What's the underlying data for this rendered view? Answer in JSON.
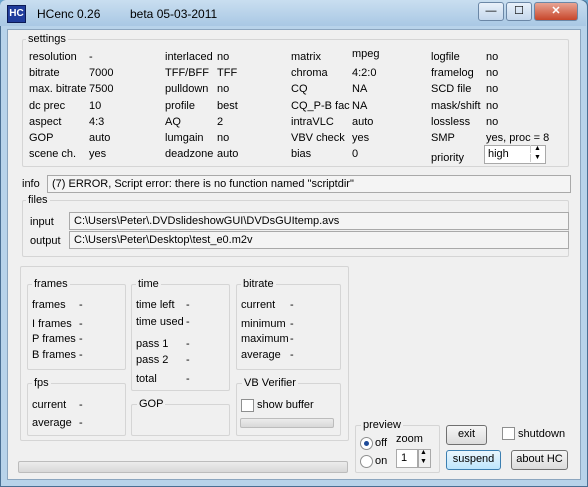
{
  "window": {
    "app_name": "HCenc 0.26",
    "version": "beta 05-03-2011",
    "logo_text": "HC",
    "minimize_glyph": "—",
    "maximize_glyph": "☐",
    "close_glyph": "✕"
  },
  "settings": {
    "title": "settings",
    "col1": [
      {
        "label": "resolution",
        "value": "-"
      },
      {
        "label": "bitrate",
        "value": "7000"
      },
      {
        "label": "max. bitrate",
        "value": "7500"
      },
      {
        "label": "dc prec",
        "value": "10"
      },
      {
        "label": "aspect",
        "value": "4:3"
      },
      {
        "label": "GOP",
        "value": "auto"
      },
      {
        "label": "scene ch.",
        "value": "yes"
      }
    ],
    "col2": [
      {
        "label": "interlaced",
        "value": "no"
      },
      {
        "label": "TFF/BFF",
        "value": "TFF"
      },
      {
        "label": "pulldown",
        "value": "no"
      },
      {
        "label": "profile",
        "value": "best"
      },
      {
        "label": "AQ",
        "value": "2"
      },
      {
        "label": "lumgain",
        "value": "no"
      },
      {
        "label": "deadzone",
        "value": "auto"
      }
    ],
    "col3": [
      {
        "label": "matrix",
        "value": "mpeg"
      },
      {
        "label": "chroma",
        "value": "4:2:0"
      },
      {
        "label": "CQ",
        "value": "NA"
      },
      {
        "label": "CQ_P-B fac",
        "value": "NA"
      },
      {
        "label": "intraVLC",
        "value": "auto"
      },
      {
        "label": "VBV check",
        "value": "yes"
      },
      {
        "label": "bias",
        "value": "0"
      }
    ],
    "col4": [
      {
        "label": "logfile",
        "value": "no"
      },
      {
        "label": "framelog",
        "value": "no"
      },
      {
        "label": "SCD file",
        "value": "no"
      },
      {
        "label": "mask/shift",
        "value": "no"
      },
      {
        "label": "lossless",
        "value": "no"
      },
      {
        "label": "SMP",
        "value": "yes,  proc = 8"
      }
    ],
    "priority": {
      "label": "priority",
      "value": "high"
    }
  },
  "info": {
    "label": "info",
    "message": "(7) ERROR, Script error: there is no function named \"scriptdir\""
  },
  "files": {
    "title": "files",
    "input_label": "input",
    "input_value": "C:\\Users\\Peter\\.DVDslideshowGUI\\DVDsGUItemp.avs",
    "output_label": "output",
    "output_value": "C:\\Users\\Peter\\Desktop\\test_e0.m2v"
  },
  "frames": {
    "title": "frames",
    "rows": [
      {
        "label": "frames",
        "value": "-"
      },
      {
        "label": "I frames",
        "value": "-"
      },
      {
        "label": "P frames",
        "value": "-"
      },
      {
        "label": "B frames",
        "value": "-"
      }
    ]
  },
  "time": {
    "title": "time",
    "rows": [
      {
        "label": "time left",
        "value": "-"
      },
      {
        "label": "time used",
        "value": "-"
      },
      {
        "label": "pass 1",
        "value": "-"
      },
      {
        "label": "pass 2",
        "value": "-"
      },
      {
        "label": "total",
        "value": "-"
      }
    ]
  },
  "bitrate": {
    "title": "bitrate",
    "rows": [
      {
        "label": "current",
        "value": "-"
      },
      {
        "label": "minimum",
        "value": "-"
      },
      {
        "label": "maximum",
        "value": "-"
      },
      {
        "label": "average",
        "value": "-"
      }
    ]
  },
  "fps": {
    "title": "fps",
    "rows": [
      {
        "label": "current",
        "value": "-"
      },
      {
        "label": "average",
        "value": "-"
      }
    ]
  },
  "gop": {
    "title": "GOP"
  },
  "vb_verifier": {
    "title": "VB Verifier",
    "show_buffer": "show buffer"
  },
  "preview": {
    "title": "preview",
    "off": "off",
    "on": "on",
    "zoom_label": "zoom",
    "zoom_value": "1",
    "selected": "off"
  },
  "buttons": {
    "exit": "exit",
    "suspend": "suspend",
    "about": "about  HC",
    "shutdown": "shutdown"
  },
  "progress": {
    "value": 0
  }
}
